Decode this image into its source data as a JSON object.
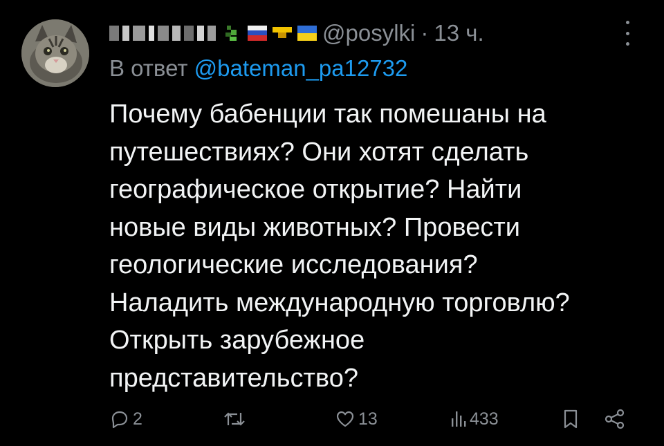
{
  "user": {
    "handle": "@posylki",
    "separator": "·",
    "time": "13 ч."
  },
  "reply": {
    "prefix": "В ответ",
    "mention": "@bateman_pa12732"
  },
  "tweet": {
    "lines": [
      "Почему бабенции так помешаны на",
      "путешествиях? Они хотят сделать",
      "географическое открытие? Найти",
      "новые виды животных? Провести",
      "геологические исследования?",
      "Наладить международную торговлю?",
      "Открыть зарубежное",
      "представительство?"
    ]
  },
  "actions": {
    "replies": "2",
    "retweets": "",
    "likes": "13",
    "views": "433"
  },
  "colors": {
    "background": "#000000",
    "text": "#f2f4f5",
    "secondary": "#8b9096",
    "accent": "#1d9bf0"
  },
  "icons": [
    "avatar-cat",
    "flag-russia",
    "flag-ukraine",
    "more-vertical-icon",
    "reply-icon",
    "retweet-icon",
    "like-icon",
    "views-icon",
    "bookmark-icon",
    "share-icon"
  ]
}
